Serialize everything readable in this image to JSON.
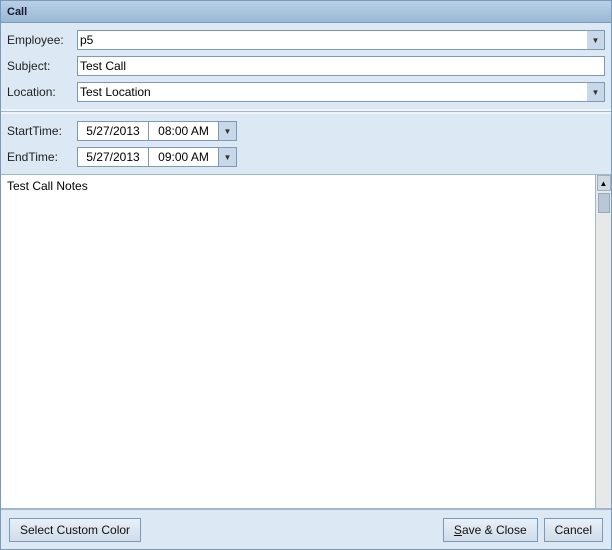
{
  "window": {
    "title": "Call"
  },
  "form": {
    "employee_label": "Employee:",
    "employee_value": "p5",
    "subject_label": "Subject:",
    "subject_value": "Test Call",
    "location_label": "Location:",
    "location_value": "Test Location",
    "start_time_label": "StartTime:",
    "start_date": "5/27/2013",
    "start_time": "08:00 AM",
    "end_time_label": "EndTime:",
    "end_date": "5/27/2013",
    "end_time": "09:00 AM",
    "notes_value": "Test Call Notes"
  },
  "footer": {
    "custom_color_label": "Select Custom Color",
    "save_close_label": "Save & Close",
    "cancel_label": "Cancel",
    "save_underline": "S"
  }
}
